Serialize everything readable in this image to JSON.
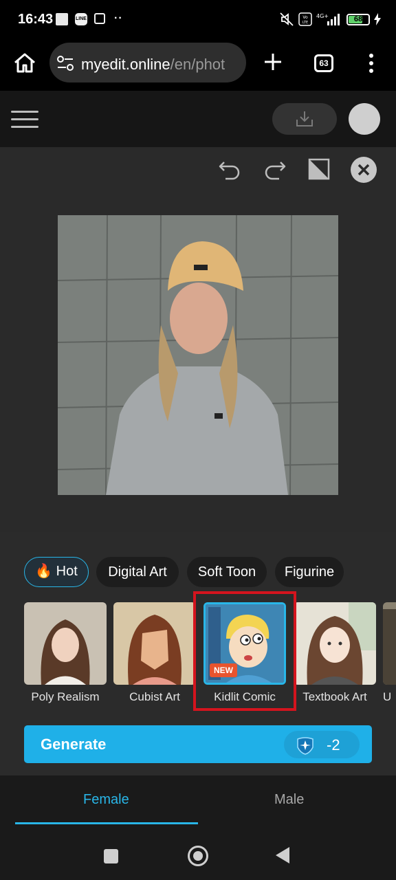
{
  "status_bar": {
    "time": "16:43",
    "battery_level": "68",
    "icons": [
      "image-notification-icon",
      "line-app-icon",
      "upload-icon",
      "more-notifications-icon",
      "mute-icon",
      "volte-icon",
      "4g-signal-icon",
      "battery-icon",
      "charging-icon"
    ]
  },
  "browser": {
    "url_domain": "myedit.online",
    "url_path": "/en/phot",
    "tab_count": "63",
    "icons": [
      "home-icon",
      "site-settings-icon",
      "plus-icon",
      "tabs-icon",
      "more-vert-icon"
    ]
  },
  "app_header": {
    "icons": [
      "menu-icon",
      "download-icon",
      "avatar"
    ]
  },
  "canvas_tools": [
    "undo-icon",
    "redo-icon",
    "compare-icon",
    "close-icon"
  ],
  "categories": [
    {
      "label": "Hot",
      "emoji": "🔥",
      "selected": true
    },
    {
      "label": "Digital Art"
    },
    {
      "label": "Soft Toon"
    },
    {
      "label": "Figurine"
    }
  ],
  "styles": [
    {
      "label": "Poly Realism"
    },
    {
      "label": "Cubist Art"
    },
    {
      "label": "Kidlit Comic",
      "badge": "NEW",
      "selected": true
    },
    {
      "label": "Textbook Art"
    },
    {
      "label": "U"
    }
  ],
  "generate": {
    "label": "Generate",
    "credits": "-2"
  },
  "gender_tabs": [
    {
      "label": "Female",
      "active": true
    },
    {
      "label": "Male"
    }
  ],
  "colors": {
    "accent": "#29b6e8",
    "generate_button": "#1fb0e8",
    "highlight": "#d4141e",
    "new_badge": "#e8542e"
  }
}
